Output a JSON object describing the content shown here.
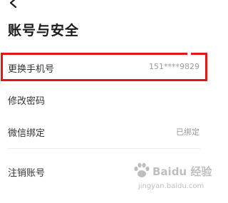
{
  "header": {
    "back_icon": "chevron-left-icon",
    "title": "账号与安全"
  },
  "settings": {
    "phone": {
      "label": "更换手机号",
      "value": "151****9829"
    },
    "password": {
      "label": "修改密码"
    },
    "wechat": {
      "label": "微信绑定",
      "value": "已绑定"
    },
    "cancel": {
      "label": "注销账号"
    }
  },
  "annotation": {
    "highlight_color": "#e01818"
  },
  "watermark": {
    "text": "Baidu 经验",
    "subtext": "jingyan.baidu.com"
  }
}
